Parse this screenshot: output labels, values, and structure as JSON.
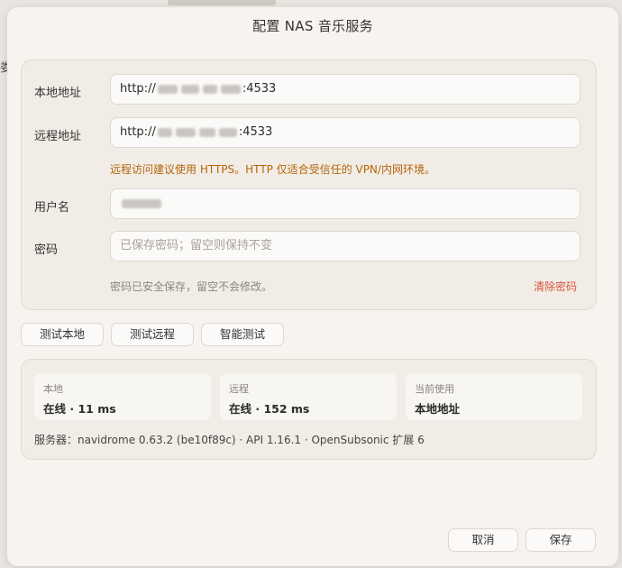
{
  "dialog": {
    "title": "配置 NAS 音乐服务"
  },
  "form": {
    "local_label": "本地地址",
    "local_prefix": "http://",
    "local_suffix": ":4533",
    "remote_label": "远程地址",
    "remote_prefix": "http://",
    "remote_suffix": ":4533",
    "remote_warning": "远程访问建议使用 HTTPS。HTTP 仅适合受信任的 VPN/内网环境。",
    "username_label": "用户名",
    "password_label": "密码",
    "password_placeholder": "已保存密码；留空则保持不变",
    "password_hint": "密码已安全保存，留空不会修改。",
    "clear_password": "清除密码"
  },
  "test_buttons": {
    "local": "测试本地",
    "remote": "测试远程",
    "smart": "智能测试"
  },
  "status": {
    "local_title": "本地",
    "local_value": "在线 · 11 ms",
    "remote_title": "远程",
    "remote_value": "在线 · 152 ms",
    "current_title": "当前使用",
    "current_value": "本地地址",
    "server_info": "服务器：navidrome 0.63.2 (be10f89c) · API 1.16.1 · OpenSubsonic 扩展 6"
  },
  "footer": {
    "cancel": "取消",
    "save": "保存"
  },
  "colors": {
    "warning": "#b5640a",
    "danger": "#d8523a",
    "dialog_bg": "#f7f4ef"
  }
}
